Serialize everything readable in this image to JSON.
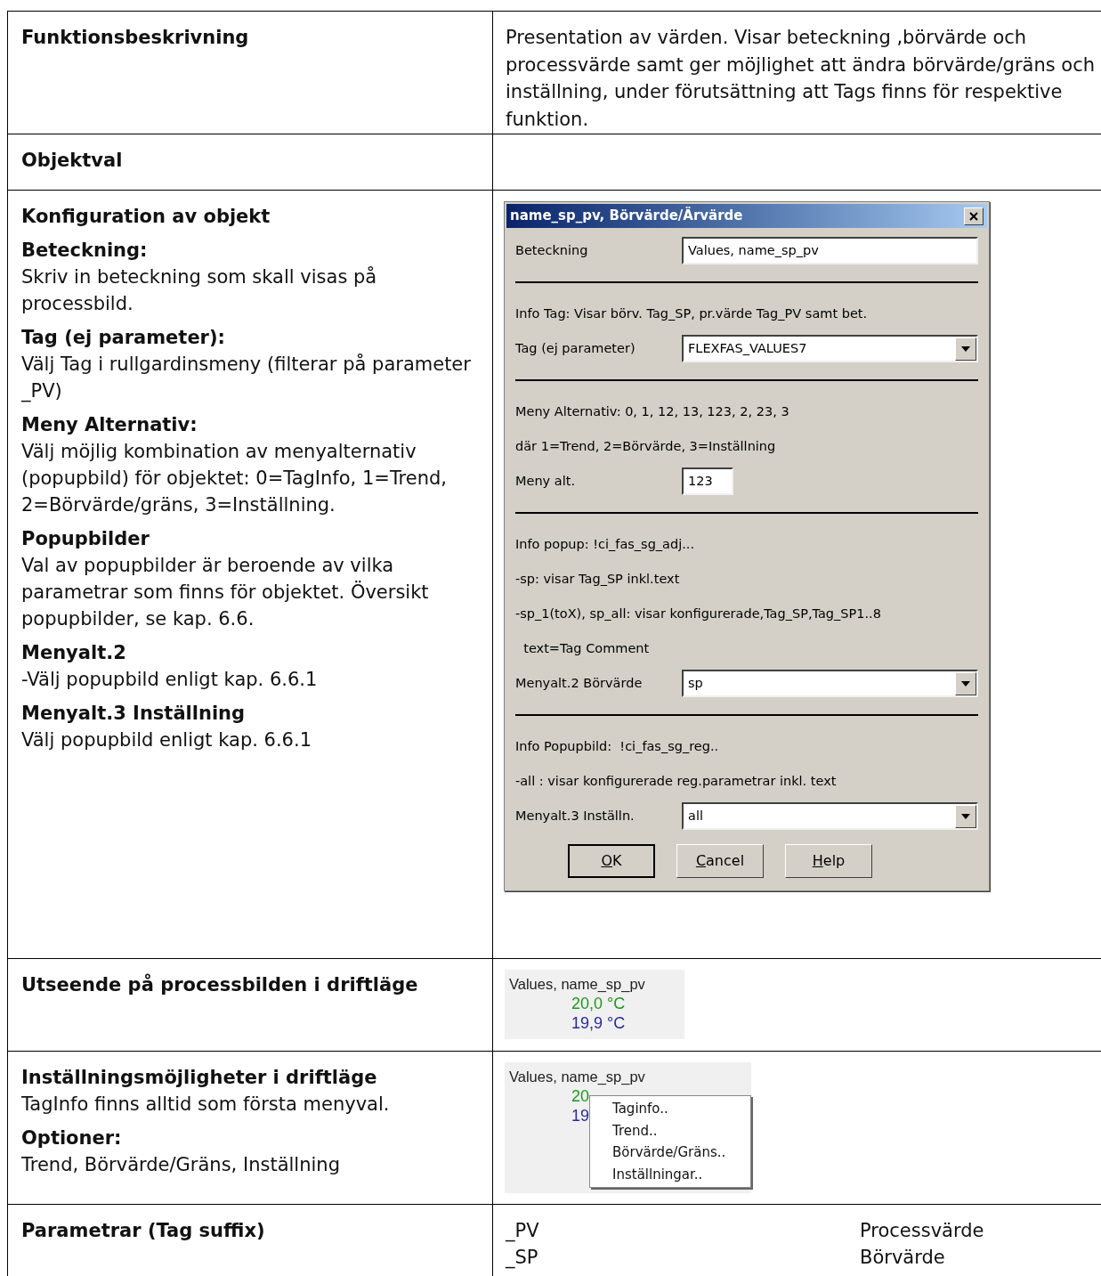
{
  "rows": [
    {
      "label": [
        {
          "kind": "heading",
          "text": "Funktionsbeskrivning"
        }
      ],
      "content": {
        "kind": "text",
        "lines": [
          "Presentation av värden.  Visar beteckning ,börvärde och processvärde samt ger möjlighet att ändra börvärde/gräns och inställning, under förutsättning att Tags finns för respektive funktion."
        ]
      }
    },
    {
      "label": [
        {
          "kind": "heading",
          "text": "Objektval"
        }
      ],
      "content": {
        "kind": "empty"
      }
    },
    {
      "label": [
        {
          "kind": "heading",
          "text": "Konfiguration av objekt"
        },
        {
          "kind": "heading",
          "text": "Beteckning:"
        },
        {
          "kind": "text",
          "text": "Skriv in beteckning som skall visas på processbild."
        },
        {
          "kind": "heading",
          "text": "Tag (ej parameter):"
        },
        {
          "kind": "text",
          "text": "Välj Tag i rullgardinsmeny (filterar på parameter _PV)"
        },
        {
          "kind": "heading",
          "text": "Meny Alternativ:"
        },
        {
          "kind": "text",
          "text": "Välj möjlig kombination av menyalternativ (popupbild) för objektet: 0=TagInfo, 1=Trend, 2=Börvärde/gräns, 3=Inställning."
        },
        {
          "kind": "heading",
          "text": "Popupbilder"
        },
        {
          "kind": "text",
          "text": "Val av popupbilder är beroende av vilka parametrar som finns för objektet. Översikt popupbilder, se kap. 6.6."
        },
        {
          "kind": "heading",
          "text": "Menyalt.2"
        },
        {
          "kind": "text",
          "text": "-Välj popupbild enligt kap. 6.6.1"
        },
        {
          "kind": "heading",
          "text": "Menyalt.3 Inställning"
        },
        {
          "kind": "text",
          "text": "Välj popupbild enligt kap. 6.6.1"
        }
      ],
      "content": {
        "kind": "dialog",
        "title": "name_sp_pv, Börvärde/Ärvärde",
        "items": [
          {
            "kind": "field",
            "label": "Beteckning",
            "value": "Values, name_sp_pv"
          },
          {
            "kind": "separator"
          },
          {
            "kind": "info",
            "text": "Info Tag: Visar börv. Tag_SP, pr.värde Tag_PV samt bet."
          },
          {
            "kind": "combo",
            "label": "Tag (ej parameter)",
            "value": "FLEXFAS_VALUES7"
          },
          {
            "kind": "separator"
          },
          {
            "kind": "info",
            "text": "Meny Alternativ: 0, 1, 12, 13, 123, 2, 23, 3"
          },
          {
            "kind": "info",
            "text": "där 1=Trend, 2=Börvärde, 3=Inställning"
          },
          {
            "kind": "short_field",
            "label": "Meny alt.",
            "value": "123"
          },
          {
            "kind": "separator"
          },
          {
            "kind": "info",
            "text": "Info popup: !ci_fas_sg_adj..."
          },
          {
            "kind": "info",
            "text": "-sp: visar Tag_SP inkl.text"
          },
          {
            "kind": "info",
            "text": "-sp_1(toX), sp_all: visar konfigurerade,Tag_SP,Tag_SP1..8"
          },
          {
            "kind": "info",
            "text": "  text=Tag Comment"
          },
          {
            "kind": "combo",
            "label": "Menyalt.2 Börvärde",
            "value": "sp"
          },
          {
            "kind": "separator"
          },
          {
            "kind": "info",
            "text": "Info Popupbild:  !ci_fas_sg_reg.."
          },
          {
            "kind": "info",
            "text": "-all : visar konfigurerade reg.parametrar inkl. text"
          },
          {
            "kind": "combo",
            "label": "Menyalt.3 Inställn.",
            "value": "all"
          }
        ],
        "buttons": [
          {
            "label": "OK",
            "default": true
          },
          {
            "label": "Cancel",
            "default": false
          },
          {
            "label": "Help",
            "default": false
          }
        ]
      }
    },
    {
      "label": [
        {
          "kind": "heading",
          "text": "Utseende på processbilden i driftläge"
        }
      ],
      "content": {
        "kind": "display",
        "title": "Values, name_sp_pv",
        "readings": [
          {
            "text": "20,0  °C",
            "color": "#1a9a1a"
          },
          {
            "text": "19,9  °C",
            "color": "#2a2aa0"
          }
        ]
      }
    },
    {
      "label": [
        {
          "kind": "heading",
          "text": "Inställningsmöjligheter i driftläge"
        },
        {
          "kind": "text",
          "text": "TagInfo finns alltid som första menyval."
        },
        {
          "kind": "heading",
          "text": "Optioner:"
        },
        {
          "kind": "text",
          "text": "Trend, Börvärde/Gräns, Inställning"
        }
      ],
      "content": {
        "kind": "display",
        "title": "Values, name_sp_pv",
        "readings": [
          {
            "text": "20",
            "color": "#1a9a1a"
          },
          {
            "text": "19",
            "color": "#2a2aa0"
          }
        ],
        "menu": [
          "Taginfo..",
          "Trend..",
          "Börvärde/Gräns..",
          "Inställningar.."
        ]
      }
    },
    {
      "label": [
        {
          "kind": "heading",
          "text": "Parametrar (Tag suffix)"
        }
      ],
      "content": {
        "kind": "params",
        "items": [
          {
            "suffix": "_PV",
            "meaning": "Processvärde"
          },
          {
            "suffix": "_SP",
            "meaning": "Börvärde"
          }
        ]
      }
    }
  ]
}
